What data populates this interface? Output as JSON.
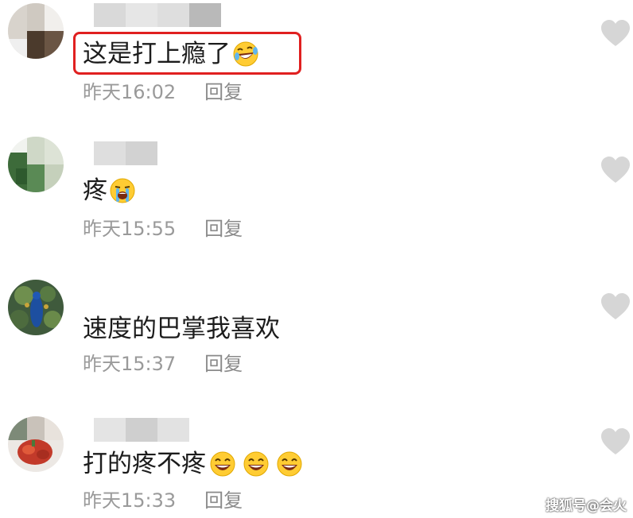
{
  "comments": [
    {
      "text": "这是打上瘾了",
      "emojis": [
        "rofl-emoji"
      ],
      "time": "昨天16:02",
      "reply_label": "回复",
      "highlighted": true
    },
    {
      "text": "疼",
      "emojis": [
        "crying-emoji"
      ],
      "time": "昨天15:55",
      "reply_label": "回复",
      "highlighted": false
    },
    {
      "text": "速度的巴掌我喜欢",
      "emojis": [],
      "time": "昨天15:37",
      "reply_label": "回复",
      "highlighted": false
    },
    {
      "text": "打的疼不疼",
      "emojis": [
        "grin-emoji",
        "grin-emoji",
        "grin-emoji"
      ],
      "time": "昨天15:33",
      "reply_label": "回复",
      "highlighted": false
    }
  ],
  "watermark": "搜狐号@会火",
  "colors": {
    "highlight_border": "#e02020",
    "text": "#1c1c1c",
    "meta": "#9a9a9a",
    "like_icon": "#d6d6d6",
    "emoji_face": "#ffcc33"
  }
}
